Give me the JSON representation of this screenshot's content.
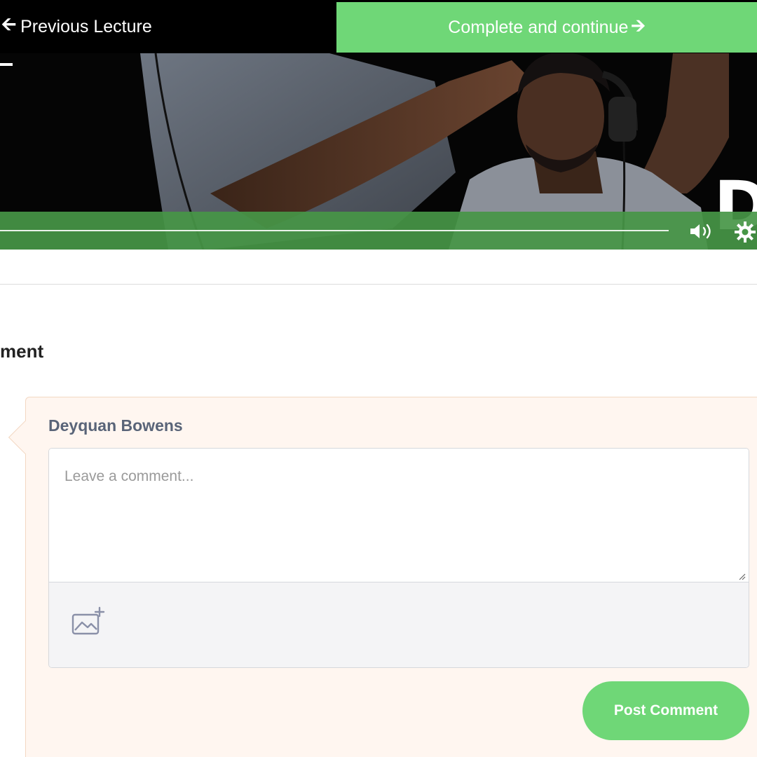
{
  "nav": {
    "prev_label": "Previous Lecture",
    "prev_icon": "arrow-left-icon",
    "complete_label": "Complete and continue",
    "complete_icon": "arrow-right-icon",
    "accent": "#6fd777"
  },
  "video": {
    "overlay_letter": "D",
    "controls_color": "#469646",
    "volume_icon": "volume-icon",
    "settings_icon": "gear-icon"
  },
  "comments": {
    "section_title": "ment",
    "author": "Deyquan Bowens",
    "placeholder": "Leave a comment...",
    "attach_icon": "image-add-icon",
    "post_label": "Post Comment"
  }
}
